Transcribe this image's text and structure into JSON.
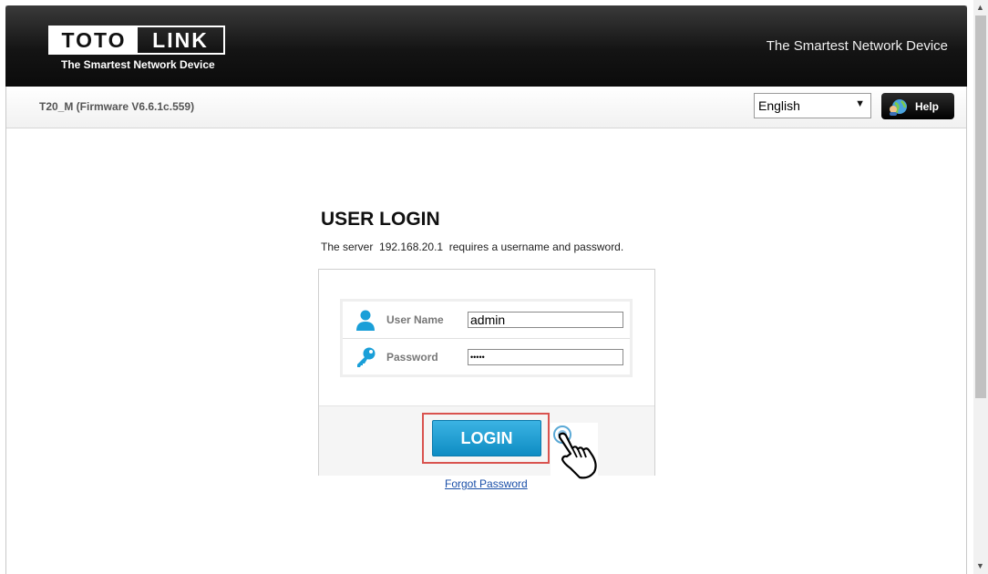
{
  "header": {
    "logo_left": "TOTO",
    "logo_right": "LINK",
    "logo_tagline": "The Smartest Network Device",
    "tagline": "The Smartest Network Device"
  },
  "subbar": {
    "firmware": "T20_M (Firmware V6.6.1c.559)",
    "language_selected": "English",
    "help_label": "Help"
  },
  "login": {
    "title": "USER LOGIN",
    "subtitle": "The server  192.168.20.1  requires a username and password.",
    "username_label": "User Name",
    "username_value": "admin",
    "password_label": "Password",
    "password_value": "•••••",
    "button_label": "LOGIN",
    "forgot_label": "Forgot Password"
  },
  "colors": {
    "accent": "#1a9fd8",
    "highlight": "#d9534f",
    "header_bg": "#141414",
    "link": "#1a4fa8"
  },
  "icons": {
    "user": "user-icon",
    "key": "key-icon",
    "help": "help-globe-icon",
    "cursor": "hand-pointer-icon"
  }
}
